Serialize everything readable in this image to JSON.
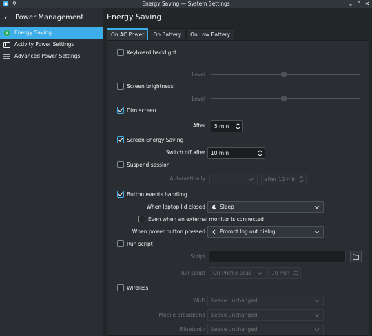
{
  "window": {
    "title": "Energy Saving — System Settings"
  },
  "sidebar": {
    "header": "Power Management",
    "items": [
      {
        "label": "Energy Saving",
        "icon": "battery-icon",
        "active": true
      },
      {
        "label": "Activity Power Settings",
        "icon": "activity-icon"
      },
      {
        "label": "Advanced Power Settings",
        "icon": "menu-icon"
      }
    ]
  },
  "main": {
    "title": "Energy Saving",
    "tabs": [
      "On AC Power",
      "On Battery",
      "On Low Battery"
    ]
  },
  "settings": {
    "keyboard_backlight": {
      "label": "Keyboard backlight",
      "checked": false,
      "level_label": "Level",
      "level": 0.49
    },
    "screen_brightness": {
      "label": "Screen brightness",
      "checked": false,
      "level_label": "Level",
      "level": 0.49
    },
    "dim_screen": {
      "label": "Dim screen",
      "checked": true,
      "after_label": "After",
      "after_value": "5 min"
    },
    "screen_energy_saving": {
      "label": "Screen Energy Saving",
      "checked": true,
      "switch_off_label": "Switch off after",
      "switch_off_value": "10 min"
    },
    "suspend_session": {
      "label": "Suspend session",
      "checked": false,
      "auto_label": "Automatically",
      "after_value": "after 10 min"
    },
    "button_events": {
      "label": "Button events handling",
      "checked": true,
      "lid_label": "When laptop lid closed",
      "lid_value": "Sleep",
      "external_label": "Even when an external monitor is connected",
      "power_label": "When power button pressed",
      "power_value": "Prompt log out dialog"
    },
    "run_script": {
      "label": "Run script",
      "checked": false,
      "script_label": "Script",
      "run_label": "Run script",
      "run_value": "On Profile Load",
      "run_time": "10 min"
    },
    "wireless": {
      "label": "Wireless",
      "checked": false,
      "wifi_label": "Wi-Fi",
      "wifi_value": "Leave unchanged",
      "mobile_label": "Mobile broadband",
      "mobile_value": "Leave unchanged",
      "bt_label": "Bluetooth",
      "bt_value": "Leave unchanged"
    }
  },
  "colors": {
    "accent": "#3daee9",
    "background": "#232629",
    "panel": "#2a2e32"
  }
}
